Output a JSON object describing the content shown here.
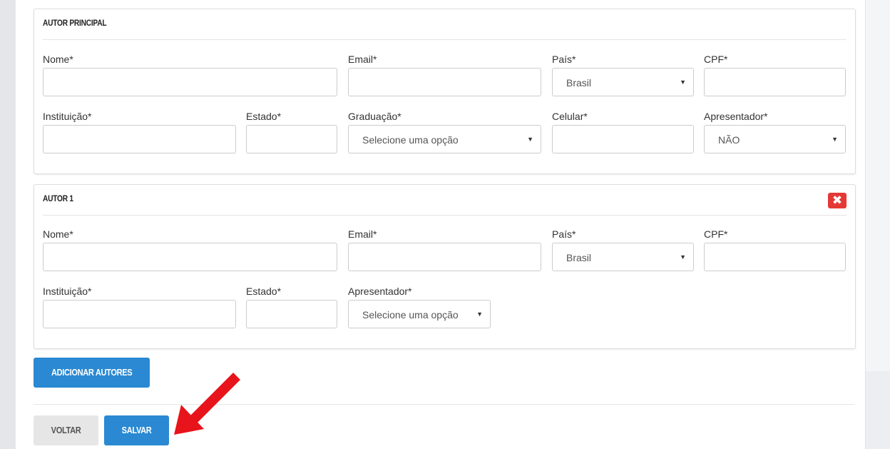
{
  "principal": {
    "title": "AUTOR PRINCIPAL",
    "labels": {
      "nome": "Nome*",
      "email": "Email*",
      "pais": "País*",
      "cpf": "CPF*",
      "instituicao": "Instituição*",
      "estado": "Estado*",
      "graduacao": "Graduação*",
      "celular": "Celular*",
      "apresentador": "Apresentador*"
    },
    "pais_value": "Brasil",
    "graduacao_value": "Selecione uma opção",
    "apresentador_value": "NÃO"
  },
  "autor1": {
    "title": "AUTOR 1",
    "delete_icon": "✖",
    "labels": {
      "nome": "Nome*",
      "email": "Email*",
      "pais": "País*",
      "cpf": "CPF*",
      "instituicao": "Instituição*",
      "estado": "Estado*",
      "apresentador": "Apresentador*"
    },
    "pais_value": "Brasil",
    "apresentador_value": "Selecione uma opção"
  },
  "actions": {
    "add_authors": "ADICIONAR AUTORES",
    "back": "VOLTAR",
    "save": "SALVAR"
  },
  "caret_glyph": "▼",
  "colors": {
    "primary": "#2a89d2",
    "danger": "#e53935",
    "annotation_arrow": "#e8141c"
  },
  "icons": {
    "delete": "close-x-icon",
    "select_caret": "caret-down-icon",
    "annotation": "red-arrow-icon"
  }
}
